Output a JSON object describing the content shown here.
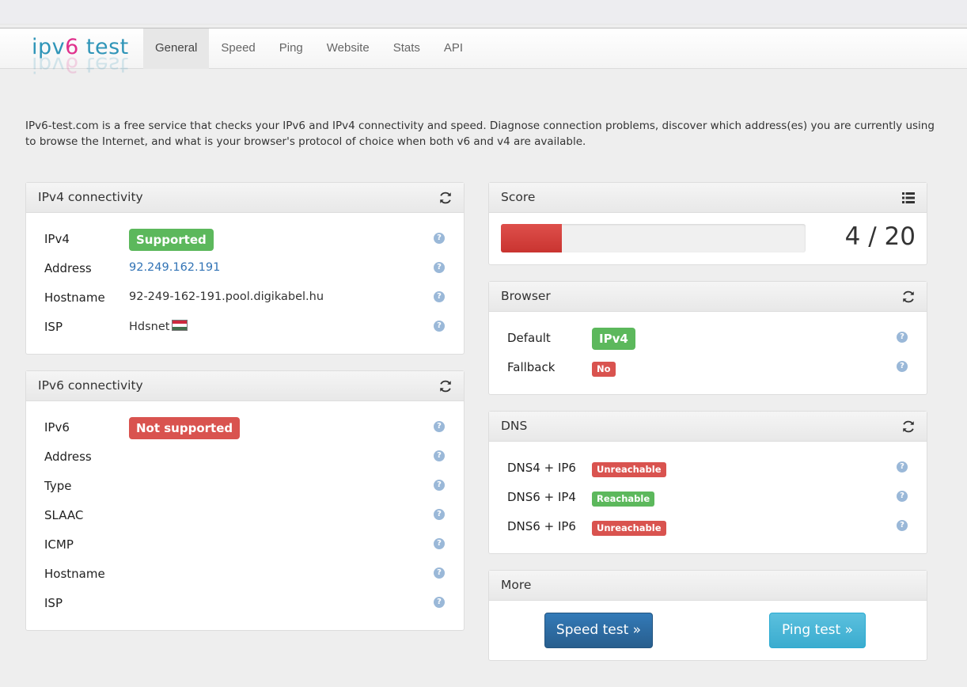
{
  "brand": {
    "part1": "ipv",
    "part2": "6",
    "part3": " test"
  },
  "nav": {
    "items": [
      {
        "label": "General",
        "active": true
      },
      {
        "label": "Speed"
      },
      {
        "label": "Ping"
      },
      {
        "label": "Website"
      },
      {
        "label": "Stats"
      },
      {
        "label": "API"
      }
    ]
  },
  "intro": "IPv6-test.com is a free service that checks your IPv6 and IPv4 connectivity and speed. Diagnose connection problems, discover which address(es) you are currently using to browse the Internet, and what is your browser's protocol of choice when both v6 and v4 are available.",
  "ipv4": {
    "title": "IPv4 connectivity",
    "rows": [
      {
        "label": "IPv4",
        "badge": "Supported"
      },
      {
        "label": "Address",
        "value": "92.249.162.191"
      },
      {
        "label": "Hostname",
        "value": "92-249-162-191.pool.digikabel.hu"
      },
      {
        "label": "ISP",
        "value": "Hdsnet"
      }
    ]
  },
  "ipv6": {
    "title": "IPv6 connectivity",
    "rows": [
      {
        "label": "IPv6",
        "badge": "Not supported"
      },
      {
        "label": "Address"
      },
      {
        "label": "Type"
      },
      {
        "label": "SLAAC"
      },
      {
        "label": "ICMP"
      },
      {
        "label": "Hostname"
      },
      {
        "label": "ISP"
      }
    ]
  },
  "score": {
    "title": "Score",
    "text": "4 / 20",
    "value": 4,
    "max": 20
  },
  "browser": {
    "title": "Browser",
    "rows": [
      {
        "label": "Default",
        "badge": "IPv4"
      },
      {
        "label": "Fallback",
        "badge": "No"
      }
    ]
  },
  "dns": {
    "title": "DNS",
    "rows": [
      {
        "label": "DNS4 + IP6",
        "badge": "Unreachable"
      },
      {
        "label": "DNS6 + IP4",
        "badge": "Reachable"
      },
      {
        "label": "DNS6 + IP6",
        "badge": "Unreachable"
      }
    ]
  },
  "more": {
    "title": "More",
    "speed_button": "Speed test »",
    "ping_button": "Ping test »"
  },
  "help_glyph": "?",
  "icons": {
    "refresh": "refresh-icon",
    "list": "list-icon",
    "help": "help-icon",
    "flag": "hungary-flag-icon"
  },
  "colors": {
    "success": "#5cb85c",
    "danger": "#d9534f",
    "link": "#3173b5",
    "primary": "#337ab7",
    "info": "#5bc0de",
    "brand_blue": "#2f95b8",
    "brand_pink": "#e0308c"
  }
}
